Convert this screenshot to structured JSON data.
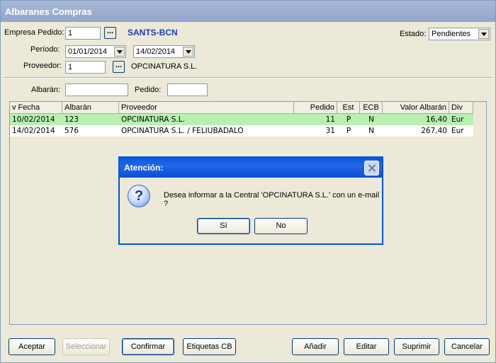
{
  "window": {
    "title": "Albaranes Compras"
  },
  "filters": {
    "empresa_label": "Empresa Pedido:",
    "empresa_value": "1",
    "empresa_name": "SANTS-BCN",
    "estado_label": "Estado:",
    "estado_value": "Pendientes",
    "periodo_label": "Período:",
    "periodo_from": "01/01/2014",
    "periodo_to": "14/02/2014",
    "proveedor_label": "Proveedor:",
    "proveedor_value": "1",
    "proveedor_name": "OPCINATURA S.L.",
    "lookup_label": "...",
    "albaran_label": "Albarán:",
    "albaran_value": "",
    "pedido_label": "Pedido:",
    "pedido_value": ""
  },
  "grid": {
    "columns": [
      "v Fecha",
      "Albarán",
      "Proveedor",
      "Pedido",
      "Est",
      "ECB",
      "Valor Albarán",
      "Div"
    ],
    "rows": [
      {
        "fecha": "10/02/2014",
        "albaran": "123",
        "proveedor": "OPCINATURA S.L.",
        "pedido": "11",
        "est": "P",
        "ecb": "N",
        "valor": "16,40",
        "div": "Eur",
        "selected": true
      },
      {
        "fecha": "14/02/2014",
        "albaran": "576",
        "proveedor": "OPCINATURA S.L. / FELIUBADALO",
        "pedido": "31",
        "est": "P",
        "ecb": "N",
        "valor": "267,40",
        "div": "Eur",
        "selected": false
      }
    ]
  },
  "dialog": {
    "title": "Atención:",
    "message": "Desea informar a la Central 'OPCINATURA S.L.' con un e-mail ?",
    "yes_label": "Sí",
    "no_label": "No",
    "icon": "question-icon"
  },
  "buttons": {
    "aceptar": "Aceptar",
    "seleccionar": "Seleccionar",
    "confirmar": "Confirmar",
    "etiquetas": "Etiquetas CB",
    "anadir": "Añadir",
    "editar": "Editar",
    "suprimir": "Suprimir",
    "cancelar": "Cancelar"
  },
  "colors": {
    "title_bar": "#9fb0d2",
    "selected_row": "#b8f0b0",
    "dialog_title": "#0a58d8",
    "empresa_name": "#1c3cb4"
  }
}
